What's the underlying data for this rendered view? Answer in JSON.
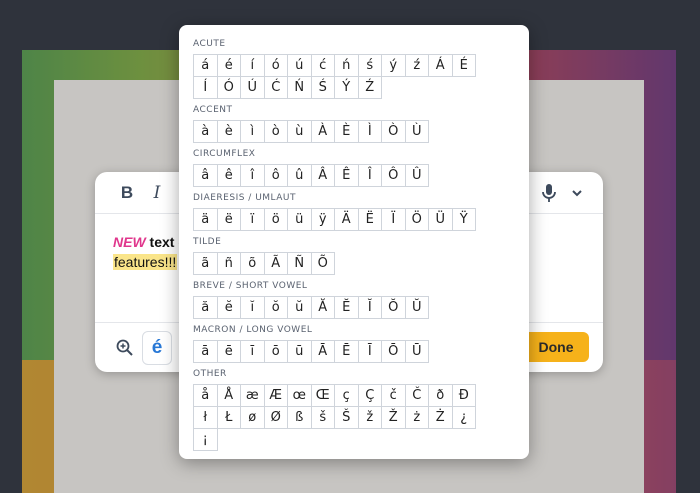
{
  "editor": {
    "toolbar": {
      "bold_label": "B",
      "italic_label": "I",
      "mic_icon": "microphone-icon",
      "chevron_icon": "chevron-down-icon"
    },
    "text_new": "NEW",
    "text_rest": " text e",
    "text_highlight": "features!!!",
    "zoom_icon": "zoom-in-icon",
    "accent_button_label": "é",
    "done_label": "Done"
  },
  "accent_popup": {
    "sections": [
      {
        "title": "ACUTE",
        "chars": [
          "á",
          "é",
          "í",
          "ó",
          "ú",
          "ć",
          "ń",
          "ś",
          "ý",
          "ź",
          "Á",
          "É",
          "Í",
          "Ó",
          "Ú",
          "Ć",
          "Ń",
          "Ś",
          "Ý",
          "Ź"
        ]
      },
      {
        "title": "ACCENT",
        "chars": [
          "à",
          "è",
          "ì",
          "ò",
          "ù",
          "À",
          "È",
          "Ì",
          "Ò",
          "Ù"
        ]
      },
      {
        "title": "CIRCUMFLEX",
        "chars": [
          "â",
          "ê",
          "î",
          "ô",
          "û",
          "Â",
          "Ê",
          "Î",
          "Ô",
          "Û"
        ]
      },
      {
        "title": "DIAERESIS / UMLAUT",
        "chars": [
          "ä",
          "ë",
          "ï",
          "ö",
          "ü",
          "ÿ",
          "Ä",
          "Ë",
          "Ï",
          "Ö",
          "Ü",
          "Ÿ"
        ]
      },
      {
        "title": "TILDE",
        "chars": [
          "ã",
          "ñ",
          "õ",
          "Ã",
          "Ñ",
          "Õ"
        ]
      },
      {
        "title": "BREVE / SHORT VOWEL",
        "chars": [
          "ă",
          "ĕ",
          "ĭ",
          "ŏ",
          "ŭ",
          "Ă",
          "Ĕ",
          "Ĭ",
          "Ŏ",
          "Ŭ"
        ]
      },
      {
        "title": "MACRON / LONG VOWEL",
        "chars": [
          "ā",
          "ē",
          "ī",
          "ō",
          "ū",
          "Ā",
          "Ē",
          "Ī",
          "Ō",
          "Ū"
        ]
      },
      {
        "title": "OTHER",
        "chars": [
          "å",
          "Å",
          "æ",
          "Æ",
          "œ",
          "Œ",
          "ç",
          "Ç",
          "č",
          "Č",
          "ð",
          "Đ",
          "ł",
          "Ł",
          "ø",
          "Ø",
          "ß",
          "š",
          "Š",
          "ž",
          "Ž",
          "ż",
          "Ż",
          "¿",
          "¡"
        ]
      }
    ]
  }
}
